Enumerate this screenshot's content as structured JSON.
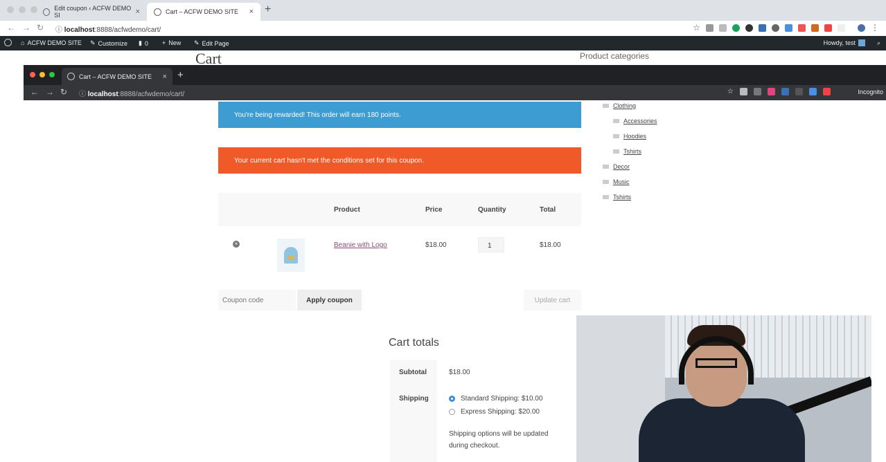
{
  "outer_browser": {
    "tabs": [
      {
        "title": "Edit coupon ‹ ACFW DEMO SI",
        "close": "×"
      },
      {
        "title": "Cart – ACFW DEMO SITE",
        "close": "×"
      }
    ],
    "new_tab": "+",
    "url_host": "localhost",
    "url_rest": ":8888/acfwdemo/cart/"
  },
  "wp_admin_bar": {
    "site_name": "ACFW DEMO SITE",
    "customize": "Customize",
    "comments_count": "0",
    "new": "New",
    "edit_page": "Edit Page",
    "howdy": "Howdy, test"
  },
  "behind_page": {
    "title": "Cart",
    "sidebar_heading": "Product categories"
  },
  "inner_browser": {
    "tab_title": "Cart – ACFW DEMO SITE",
    "tab_close": "×",
    "new_tab": "+",
    "url_host": "localhost",
    "url_rest": ":8888/acfwdemo/cart/",
    "incognito": "Incognito"
  },
  "notices": {
    "info": "You're being rewarded! This order will earn 180 points.",
    "error": "Your current cart hasn't met the conditions set for this coupon."
  },
  "cart_table": {
    "headers": [
      "Product",
      "Price",
      "Quantity",
      "Total"
    ],
    "rows": [
      {
        "product": "Beanie with Logo",
        "price": "$18.00",
        "quantity": "1",
        "total": "$18.00"
      }
    ]
  },
  "coupon": {
    "placeholder": "Coupon code",
    "apply_label": "Apply coupon",
    "update_label": "Update cart"
  },
  "cart_totals": {
    "title": "Cart totals",
    "subtotal_label": "Subtotal",
    "subtotal_value": "$18.00",
    "shipping_label": "Shipping",
    "shipping_options": [
      {
        "label": "Standard Shipping: $10.00",
        "selected": true
      },
      {
        "label": "Express Shipping: $20.00",
        "selected": false
      }
    ],
    "shipping_note_1": "Shipping options will be updated",
    "shipping_note_2": "during checkout."
  },
  "categories": [
    {
      "name": "Clothing",
      "level": 0
    },
    {
      "name": "Accessories",
      "level": 1
    },
    {
      "name": "Hoodies",
      "level": 1
    },
    {
      "name": "Tshirts",
      "level": 1
    },
    {
      "name": "Decor",
      "level": 0
    },
    {
      "name": "Music",
      "level": 0
    },
    {
      "name": "Tshirts",
      "level": 0
    }
  ],
  "colors": {
    "info": "#3d9cd2",
    "error": "#f05a28",
    "admin_bar": "#23282d",
    "link": "#8a4d7a"
  }
}
